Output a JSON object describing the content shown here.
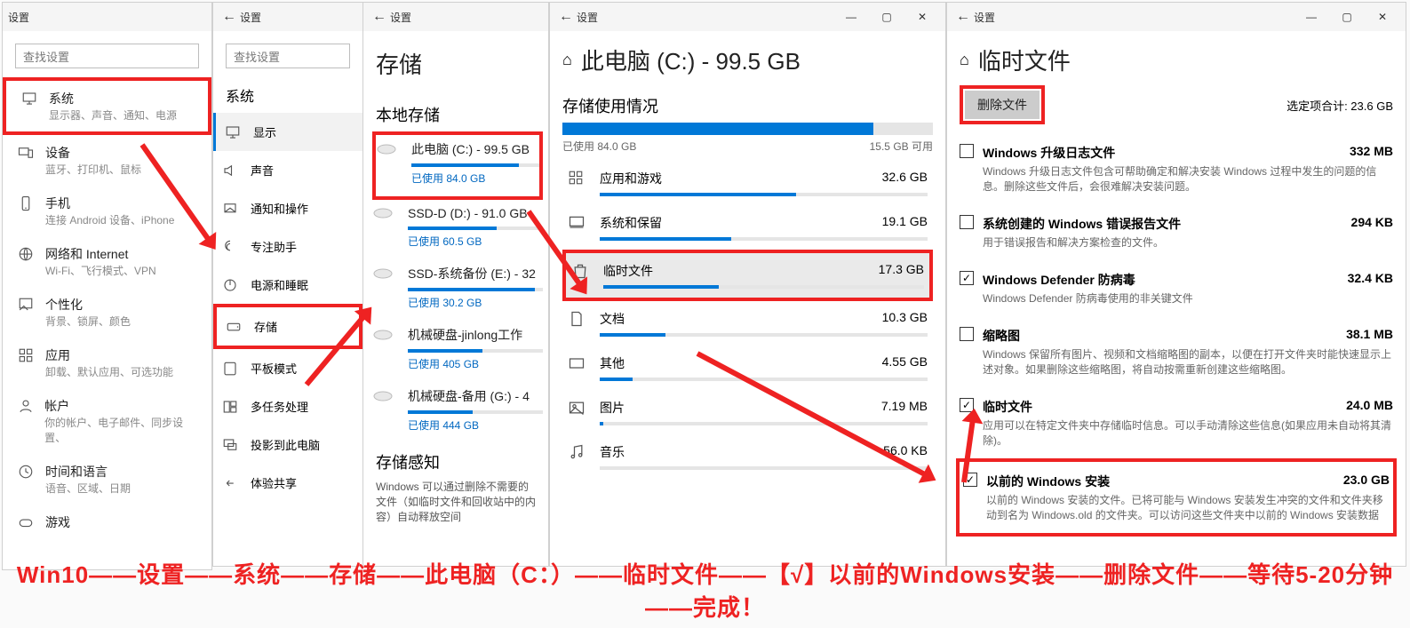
{
  "w1": {
    "title": "设置",
    "search_placeholder": "查找设置",
    "items": [
      {
        "icon": "monitor",
        "title": "系统",
        "sub": "显示器、声音、通知、电源"
      },
      {
        "icon": "devices",
        "title": "设备",
        "sub": "蓝牙、打印机、鼠标"
      },
      {
        "icon": "phone",
        "title": "手机",
        "sub": "连接 Android 设备、iPhone"
      },
      {
        "icon": "globe",
        "title": "网络和 Internet",
        "sub": "Wi-Fi、飞行模式、VPN"
      },
      {
        "icon": "palette",
        "title": "个性化",
        "sub": "背景、锁屏、颜色"
      },
      {
        "icon": "apps",
        "title": "应用",
        "sub": "卸载、默认应用、可选功能"
      },
      {
        "icon": "account",
        "title": "帐户",
        "sub": "你的帐户、电子邮件、同步设置、"
      },
      {
        "icon": "time",
        "title": "时间和语言",
        "sub": "语音、区域、日期"
      },
      {
        "icon": "game",
        "title": "游戏",
        "sub": ""
      }
    ]
  },
  "w2": {
    "back": "←",
    "title": "设置",
    "search_placeholder": "查找设置",
    "section": "系统",
    "items": [
      {
        "icon": "monitor",
        "label": "显示"
      },
      {
        "icon": "sound",
        "label": "声音"
      },
      {
        "icon": "notify",
        "label": "通知和操作"
      },
      {
        "icon": "focus",
        "label": "专注助手"
      },
      {
        "icon": "power",
        "label": "电源和睡眠"
      },
      {
        "icon": "storage",
        "label": "存储"
      },
      {
        "icon": "tablet",
        "label": "平板模式"
      },
      {
        "icon": "multi",
        "label": "多任务处理"
      },
      {
        "icon": "project",
        "label": "投影到此电脑"
      },
      {
        "icon": "share",
        "label": "体验共享"
      }
    ]
  },
  "w3": {
    "back": "←",
    "title": "设置",
    "h1": "存储",
    "h2": "本地存储",
    "sense": "存储感知",
    "sense_desc": "Windows 可以通过删除不需要的文件（如临时文件和回收站中的内容）自动释放空间",
    "drives": [
      {
        "name": "此电脑 (C:) - 99.5 GB",
        "used": "已使用 84.0 GB",
        "pct": 84
      },
      {
        "name": "SSD-D (D:) - 91.0 GB",
        "used": "已使用 60.5 GB",
        "pct": 66
      },
      {
        "name": "SSD-系统备份 (E:) - 32",
        "used": "已使用 30.2 GB",
        "pct": 94
      },
      {
        "name": "机械硬盘-jinlong工作",
        "used": "已使用 405 GB",
        "pct": 55
      },
      {
        "name": "机械硬盘-备用 (G:) - 4",
        "used": "已使用 444 GB",
        "pct": 48
      }
    ]
  },
  "w4": {
    "back": "←",
    "title": "设置",
    "h1_prefix": "此电脑 (C:) - 99.5 GB",
    "h2": "存储使用情况",
    "overall_pct": 84,
    "overall_used": "已使用 84.0 GB",
    "overall_free": "15.5 GB 可用",
    "cats": [
      {
        "icon": "apps",
        "label": "应用和游戏",
        "size": "32.6 GB",
        "pct": 60
      },
      {
        "icon": "system",
        "label": "系统和保留",
        "size": "19.1 GB",
        "pct": 40
      },
      {
        "icon": "trash",
        "label": "临时文件",
        "size": "17.3 GB",
        "pct": 36
      },
      {
        "icon": "docs",
        "label": "文档",
        "size": "10.3 GB",
        "pct": 20
      },
      {
        "icon": "other",
        "label": "其他",
        "size": "4.55 GB",
        "pct": 10
      },
      {
        "icon": "image",
        "label": "图片",
        "size": "7.19 MB",
        "pct": 1
      },
      {
        "icon": "music",
        "label": "音乐",
        "size": "56.0 KB",
        "pct": 0
      }
    ]
  },
  "w5": {
    "back": "←",
    "title": "设置",
    "h1": "临时文件",
    "delete_btn": "删除文件",
    "total_label": "选定项合计: 23.6 GB",
    "items": [
      {
        "checked": false,
        "title": "Windows 升级日志文件",
        "size": "332 MB",
        "desc": "Windows 升级日志文件包含可帮助确定和解决安装 Windows 过程中发生的问题的信息。删除这些文件后，会很难解决安装问题。"
      },
      {
        "checked": false,
        "title": "系统创建的 Windows 错误报告文件",
        "size": "294 KB",
        "desc": "用于错误报告和解决方案检查的文件。"
      },
      {
        "checked": true,
        "title": "Windows Defender 防病毒",
        "size": "32.4 KB",
        "desc": "Windows Defender 防病毒使用的非关键文件"
      },
      {
        "checked": false,
        "title": "缩略图",
        "size": "38.1 MB",
        "desc": "Windows 保留所有图片、视频和文档缩略图的副本，以便在打开文件夹时能快速显示上述对象。如果删除这些缩略图，将自动按需重新创建这些缩略图。"
      },
      {
        "checked": true,
        "title": "临时文件",
        "size": "24.0 MB",
        "desc": "应用可以在特定文件夹中存储临时信息。可以手动清除这些信息(如果应用未自动将其清除)。"
      },
      {
        "checked": true,
        "title": "以前的 Windows 安装",
        "size": "23.0 GB",
        "desc": "以前的 Windows 安装的文件。已将可能与 Windows 安装发生冲突的文件和文件夹移动到名为 Windows.old 的文件夹。可以访问这些文件夹中以前的 Windows 安装数据"
      }
    ]
  },
  "footer": "Win10——设置——系统——存储——此电脑（C：）——临时文件——【√】以前的Windows安装——删除文件——等待5-20分钟——完成！"
}
